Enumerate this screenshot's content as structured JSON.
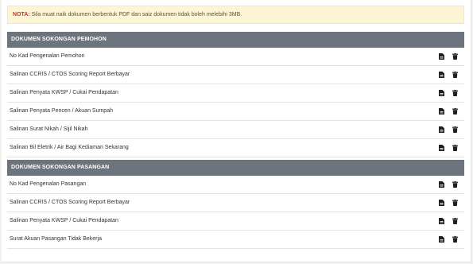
{
  "note": {
    "prefix": "NOTA:",
    "text": " Sila muat naik dokumen berbentuk PDF dan saiz dokumen tidak boleh melebihi 3MB."
  },
  "sections": [
    {
      "title": "DOKUMEN SOKONGAN PEMOHON",
      "items": [
        "No Kad Pengenalan Pemohon",
        "Salinan CCRIS / CTOS Scoring Report Berbayar",
        "Salinan Penyata KWSP / Cukai Pendapatan",
        "Salinan Penyata Pencen / Akuan Sumpah",
        "Salinan Surat Nikah / Sijil Nikah",
        "Salinan Bil Eletrik / Air Bagi Kediaman Sekarang"
      ]
    },
    {
      "title": "DOKUMEN SOKONGAN PASANGAN",
      "items": [
        "No Kad Pengenalan Pasangan",
        "Salinan CCRIS / CTOS Scoring Report Berbayar",
        "Salinan Penyata KWSP / Cukai Pendapatan",
        "Surat Akuan Pasangan Tidak Bekerja"
      ]
    }
  ],
  "icons": {
    "file": "file-icon",
    "delete": "trash-icon"
  },
  "colors": {
    "header_bg": "#6c757d",
    "note_bg": "#fdf6d6",
    "note_prefix": "#c0392b"
  }
}
